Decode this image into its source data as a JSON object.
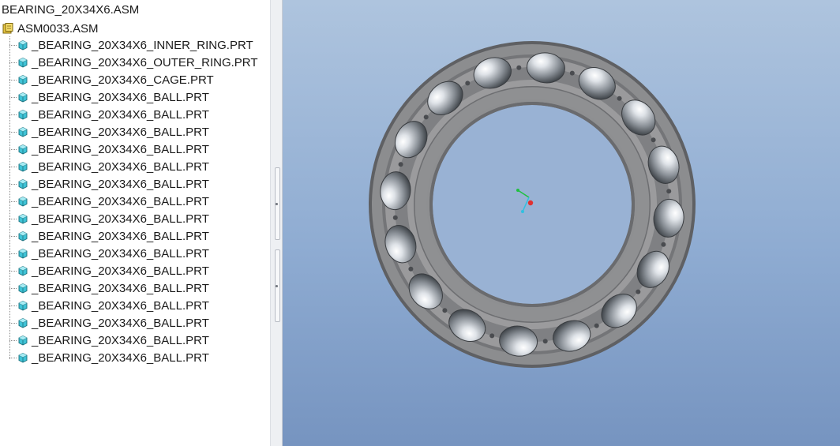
{
  "model_tree": {
    "title": "BEARING_20X34X6.ASM",
    "root": {
      "label": "ASM0033.ASM",
      "icon": "assembly-icon"
    },
    "items": [
      {
        "label": "_BEARING_20X34X6_INNER_RING.PRT",
        "icon": "part-icon"
      },
      {
        "label": "_BEARING_20X34X6_OUTER_RING.PRT",
        "icon": "part-icon"
      },
      {
        "label": "_BEARING_20X34X6_CAGE.PRT",
        "icon": "part-icon"
      },
      {
        "label": "_BEARING_20X34X6_BALL.PRT",
        "icon": "part-icon"
      },
      {
        "label": "_BEARING_20X34X6_BALL.PRT",
        "icon": "part-icon"
      },
      {
        "label": "_BEARING_20X34X6_BALL.PRT",
        "icon": "part-icon"
      },
      {
        "label": "_BEARING_20X34X6_BALL.PRT",
        "icon": "part-icon"
      },
      {
        "label": "_BEARING_20X34X6_BALL.PRT",
        "icon": "part-icon"
      },
      {
        "label": "_BEARING_20X34X6_BALL.PRT",
        "icon": "part-icon"
      },
      {
        "label": "_BEARING_20X34X6_BALL.PRT",
        "icon": "part-icon"
      },
      {
        "label": "_BEARING_20X34X6_BALL.PRT",
        "icon": "part-icon"
      },
      {
        "label": "_BEARING_20X34X6_BALL.PRT",
        "icon": "part-icon"
      },
      {
        "label": "_BEARING_20X34X6_BALL.PRT",
        "icon": "part-icon"
      },
      {
        "label": "_BEARING_20X34X6_BALL.PRT",
        "icon": "part-icon"
      },
      {
        "label": "_BEARING_20X34X6_BALL.PRT",
        "icon": "part-icon"
      },
      {
        "label": "_BEARING_20X34X6_BALL.PRT",
        "icon": "part-icon"
      },
      {
        "label": "_BEARING_20X34X6_BALL.PRT",
        "icon": "part-icon"
      },
      {
        "label": "_BEARING_20X34X6_BALL.PRT",
        "icon": "part-icon"
      },
      {
        "label": "_BEARING_20X34X6_BALL.PRT",
        "icon": "part-icon"
      }
    ]
  },
  "viewport": {
    "model": "bearing-assembly",
    "ball_count": 16,
    "colors": {
      "background_top": "#aec4de",
      "background_bottom": "#7694c0",
      "ring": "#8a8a8a",
      "ball": "#9aa0a6",
      "origin_x_axis": "#e03030",
      "origin_y_axis": "#20c040",
      "origin_z_axis": "#30c0e0"
    }
  }
}
